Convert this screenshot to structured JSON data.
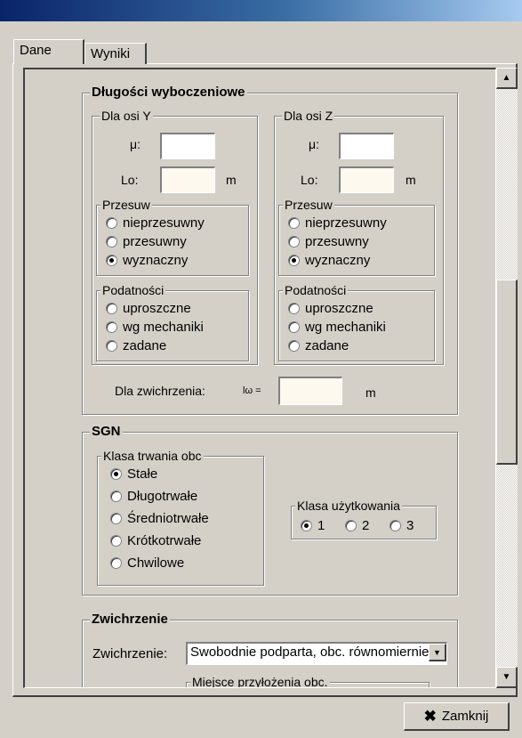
{
  "tabs": [
    "Dane",
    "Wyniki"
  ],
  "buckling": {
    "title": "Długości wyboczeniowe",
    "axis_y": {
      "title": "Dla osi Y",
      "mu_label": "μ:",
      "lo_label": "Lo:",
      "unit": "m",
      "sway_title": "Przesuw",
      "sway_options": [
        "nieprzesuwny",
        "przesuwny",
        "wyznaczny"
      ],
      "sway_selected": "wyznaczny",
      "flex_title": "Podatności",
      "flex_options": [
        "uproszczne",
        "wg mechaniki",
        "zadane"
      ]
    },
    "axis_z": {
      "title": "Dla osi Z",
      "mu_label": "μ:",
      "lo_label": "Lo:",
      "unit": "m",
      "sway_title": "Przesuw",
      "sway_options": [
        "nieprzesuwny",
        "przesuwny",
        "wyznaczny"
      ],
      "sway_selected": "wyznaczny",
      "flex_title": "Podatności",
      "flex_options": [
        "uproszczne",
        "wg mechaniki",
        "zadane"
      ]
    },
    "lt_label": "Dla zwichrzenia:",
    "lw_symbol": "lω =",
    "lt_unit": "m"
  },
  "sgn": {
    "title": "SGN",
    "load_class_title": "Klasa trwania obc",
    "load_classes": [
      "Stałe",
      "Długotrwałe",
      "Średniotrwałe",
      "Krótkotrwałe",
      "Chwilowe"
    ],
    "load_selected": "Stałe",
    "service_title": "Klasa użytkowania",
    "service_classes": [
      "1",
      "2",
      "3"
    ],
    "service_selected": "1"
  },
  "lt": {
    "title": "Zwichrzenie",
    "label": "Zwichrzenie:",
    "value": "Swobodnie podparta, obc. równomiernie",
    "load_point_title": "Miejsce przyłożenia obc."
  },
  "close_label": "Zamknij",
  "icons": {
    "close": "x-icon",
    "scroll_up": "arrow-up-icon",
    "scroll_down": "arrow-down-icon",
    "dropdown": "chevron-down-icon"
  }
}
